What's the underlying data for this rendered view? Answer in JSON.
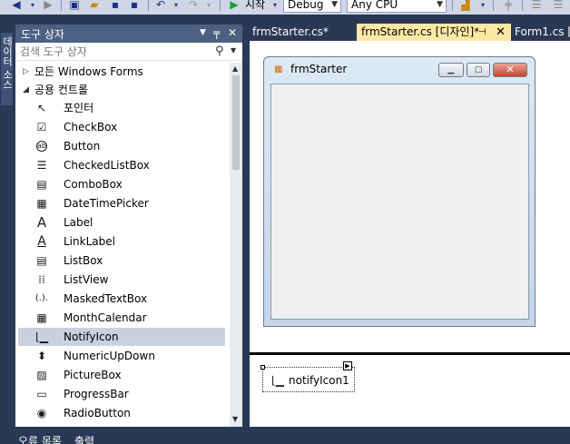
{
  "toolbar": {
    "start_label": "시작",
    "config_value": "Debug",
    "platform_value": "Any CPU"
  },
  "side_strip": {
    "tab_label": "데이터 소스"
  },
  "toolbox": {
    "title": "도구 상자",
    "pin_glyph": "▼ ╤",
    "close_glyph": "✕",
    "search_placeholder": "검색 도구 상자",
    "groups": [
      {
        "label": "모든 Windows Forms"
      },
      {
        "label": "공용 컨트롤"
      }
    ],
    "items": [
      {
        "label": "포인터",
        "icon": "↖"
      },
      {
        "label": "CheckBox",
        "icon": "☑"
      },
      {
        "label": "Button",
        "icon": "ab"
      },
      {
        "label": "CheckedListBox",
        "icon": "☰"
      },
      {
        "label": "ComboBox",
        "icon": "▤"
      },
      {
        "label": "DateTimePicker",
        "icon": "▦"
      },
      {
        "label": "Label",
        "icon": "A"
      },
      {
        "label": "LinkLabel",
        "icon": "A"
      },
      {
        "label": "ListBox",
        "icon": "▤"
      },
      {
        "label": "ListView",
        "icon": "⁞⁞"
      },
      {
        "label": "MaskedTextBox",
        "icon": "(.)."
      },
      {
        "label": "MonthCalendar",
        "icon": "▦"
      },
      {
        "label": "NotifyIcon",
        "icon": "⌊▁"
      },
      {
        "label": "NumericUpDown",
        "icon": "⬍"
      },
      {
        "label": "PictureBox",
        "icon": "▨"
      },
      {
        "label": "ProgressBar",
        "icon": "▭"
      },
      {
        "label": "RadioButton",
        "icon": "◉"
      }
    ],
    "selected_index": 12
  },
  "tabs": [
    {
      "label": "frmStarter.cs*"
    },
    {
      "label": "frmStarter.cs [디자인]*"
    },
    {
      "label": "Form1.cs ["
    }
  ],
  "designer": {
    "form_title": "frmStarter"
  },
  "tray": {
    "component_label": "notifyIcon1"
  },
  "bottom_tabs": [
    {
      "label": "오류 목록"
    },
    {
      "label": "출력"
    }
  ]
}
